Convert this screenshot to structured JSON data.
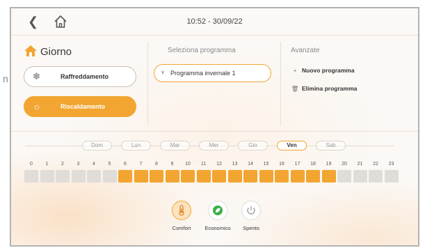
{
  "header": {
    "datetime": "10:52 - 30/09/22"
  },
  "mode": {
    "title": "Giorno",
    "cool_label": "Raffreddamento",
    "heat_label": "Riscaldamento"
  },
  "program": {
    "section_title": "Seleziona programma",
    "selected": "Programma invernale 1"
  },
  "advanced": {
    "section_title": "Avanzate",
    "new_label": "Nuovo programma",
    "delete_label": "Elimina programma"
  },
  "days": [
    "Dom",
    "Lun",
    "Mar",
    "Mer",
    "Gio",
    "Ven",
    "Sab"
  ],
  "active_day": "Ven",
  "hours": [
    "0",
    "1",
    "2",
    "3",
    "4",
    "5",
    "6",
    "7",
    "8",
    "9",
    "10",
    "11",
    "12",
    "13",
    "14",
    "15",
    "16",
    "17",
    "18",
    "19",
    "20",
    "21",
    "22",
    "23"
  ],
  "hour_states": [
    0,
    0,
    0,
    0,
    0,
    0,
    1,
    1,
    1,
    1,
    1,
    1,
    1,
    1,
    1,
    1,
    1,
    1,
    1,
    1,
    0,
    0,
    0,
    0
  ],
  "temp_modes": {
    "comfort_label": "Comfort",
    "eco_label": "Economico",
    "off_label": "Spento"
  },
  "side_text": "n",
  "colors": {
    "accent": "#f2a531",
    "eco_green": "#3fae4a",
    "inactive": "#e0dcd8"
  }
}
